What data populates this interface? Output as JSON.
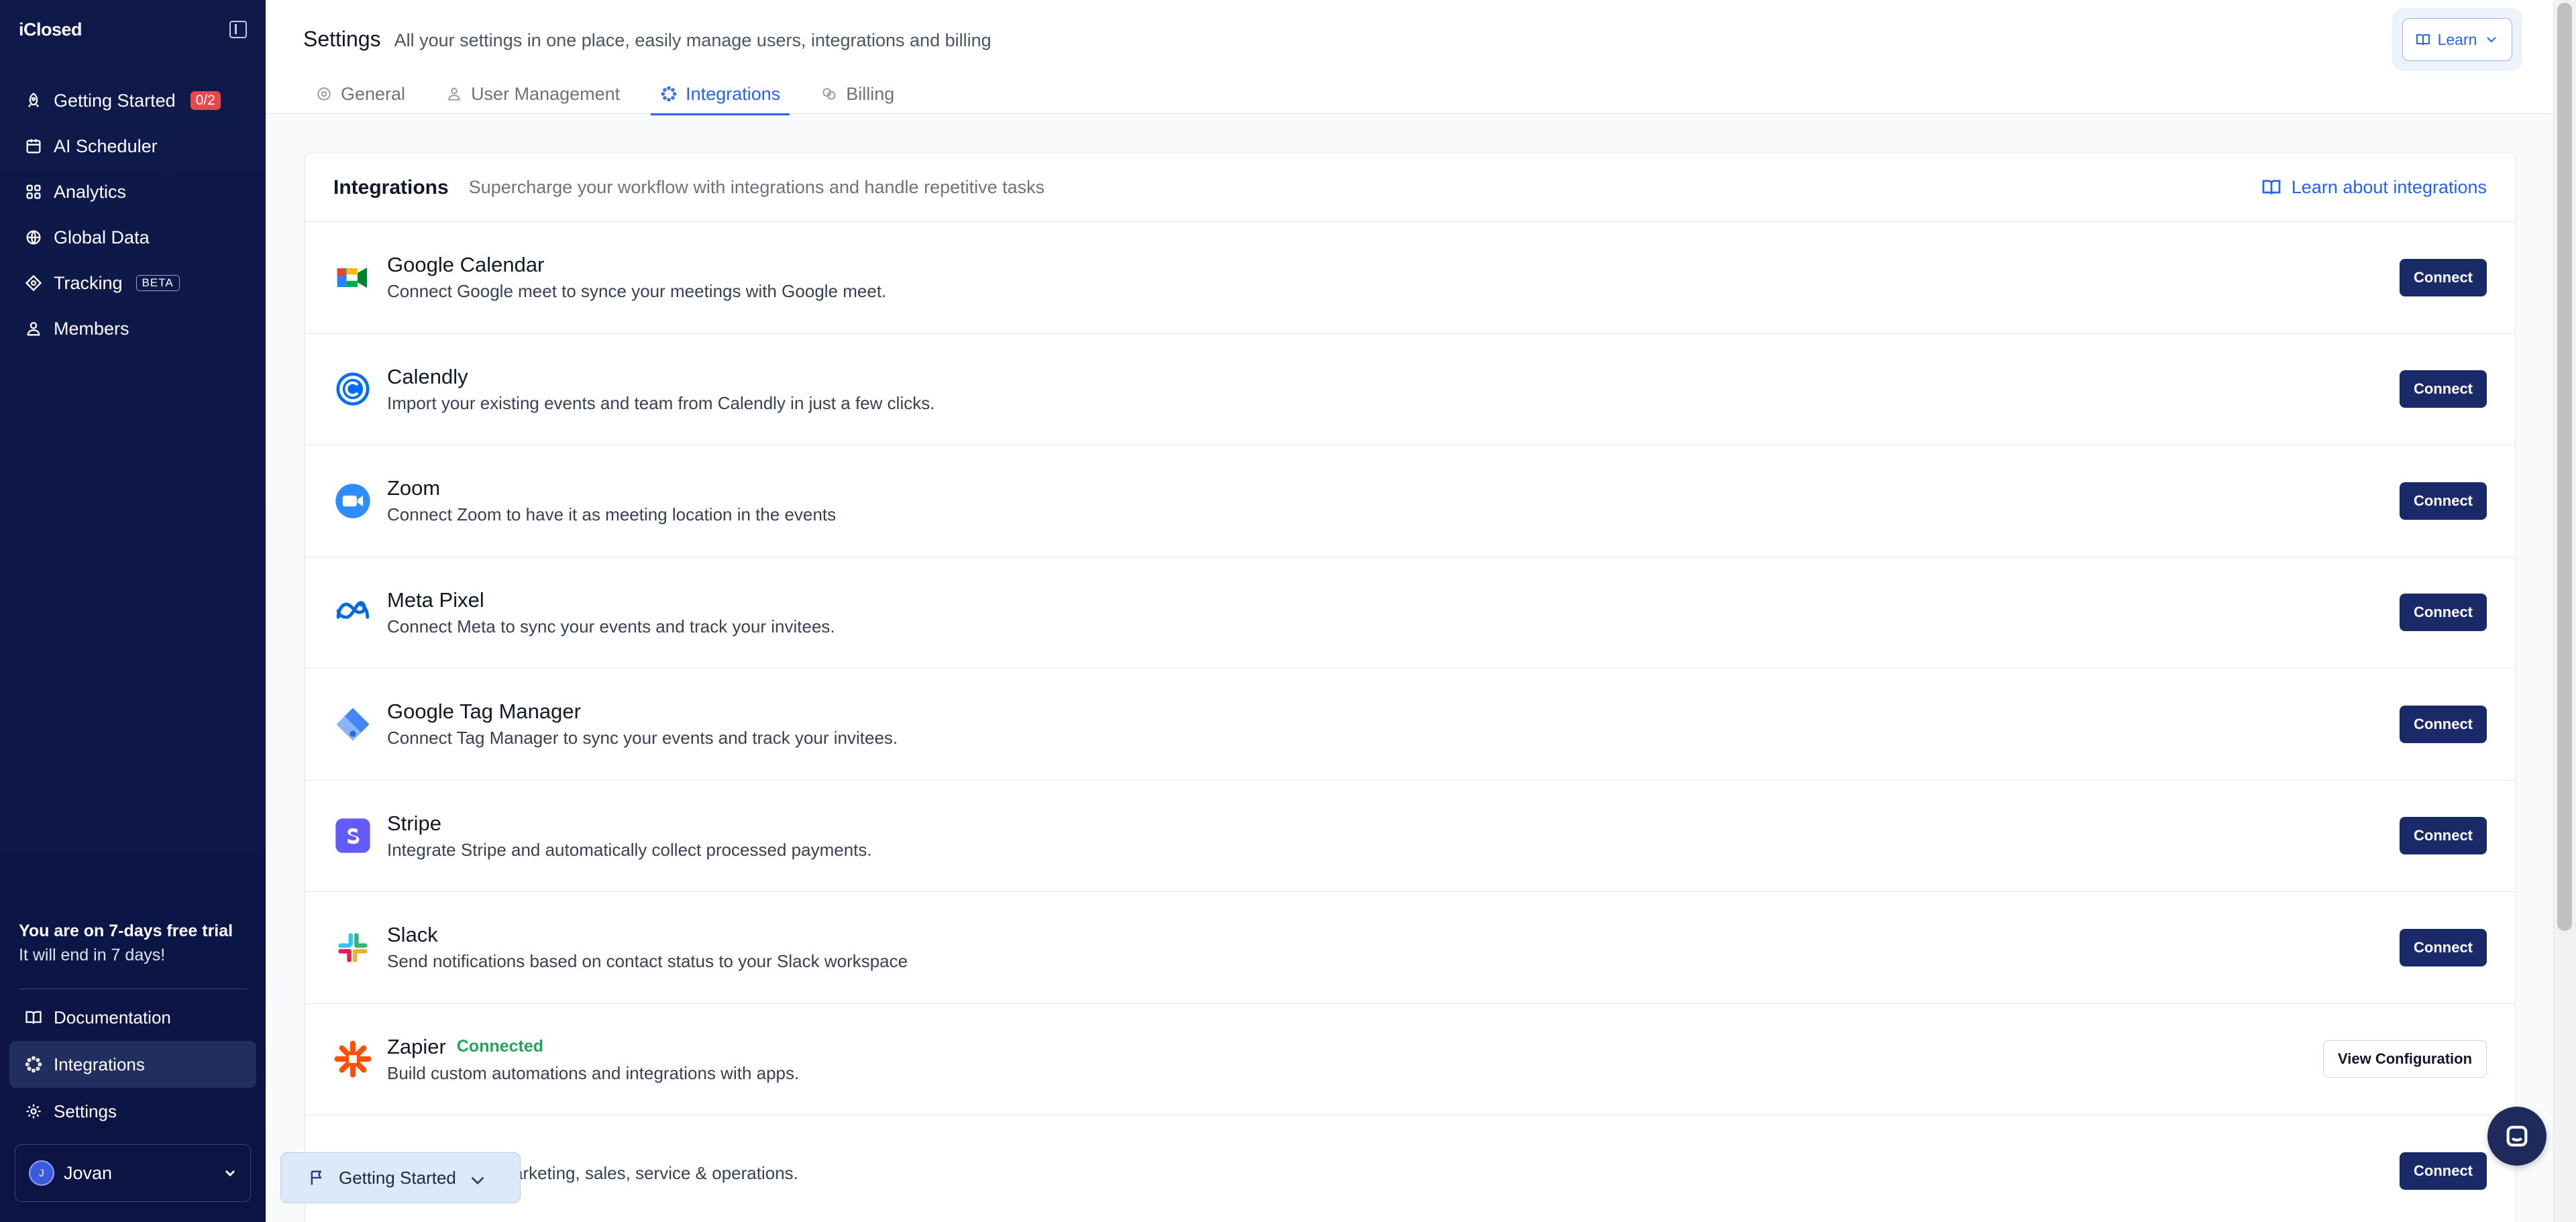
{
  "sidebar": {
    "logo": "iClosed",
    "nav": [
      {
        "label": "Getting Started",
        "icon": "rocket-icon",
        "badge": "0/2"
      },
      {
        "label": "AI Scheduler",
        "icon": "calendar-icon"
      },
      {
        "label": "Analytics",
        "icon": "grid-icon"
      },
      {
        "label": "Global Data",
        "icon": "globe-icon"
      },
      {
        "label": "Tracking",
        "icon": "target-icon",
        "tag": "BETA"
      },
      {
        "label": "Members",
        "icon": "users-icon"
      }
    ],
    "trial_title": "You are on 7-days free trial",
    "trial_sub": "It will end in 7 days!",
    "bottom": [
      {
        "label": "Documentation",
        "icon": "book-icon"
      },
      {
        "label": "Integrations",
        "icon": "integrations-icon"
      },
      {
        "label": "Settings",
        "icon": "gear-icon"
      }
    ],
    "user": {
      "initial": "J",
      "name": "Jovan"
    }
  },
  "header": {
    "title": "Settings",
    "subtitle": "All your settings in one place, easily manage users, integrations and billing",
    "tabs": [
      {
        "label": "General"
      },
      {
        "label": "User Management"
      },
      {
        "label": "Integrations"
      },
      {
        "label": "Billing"
      }
    ],
    "active_tab": "Integrations",
    "learn_label": "Learn"
  },
  "card": {
    "title": "Integrations",
    "subtitle": "Supercharge your workflow with integrations and handle repetitive tasks",
    "learn_link": "Learn about integrations",
    "items": [
      {
        "name": "Google Calendar",
        "desc": "Connect Google meet to syncе your meetings with Google meet.",
        "action": "Connect",
        "icon": "google-meet-icon"
      },
      {
        "name": "Calendly",
        "desc": "Import your existing events and team from Calendly in just a few clicks.",
        "action": "Connect",
        "icon": "calendly-icon"
      },
      {
        "name": "Zoom",
        "desc": "Connect Zoom to have it as meeting location in the events",
        "action": "Connect",
        "icon": "zoom-icon"
      },
      {
        "name": "Meta Pixel",
        "desc": "Connect Meta to sync your events and track your invitees.",
        "action": "Connect",
        "icon": "meta-icon"
      },
      {
        "name": "Google Tag Manager",
        "desc": "Connect Tag Manager to sync your events and track your invitees.",
        "action": "Connect",
        "icon": "gtm-icon"
      },
      {
        "name": "Stripe",
        "desc": "Integrate Stripe and automatically collect processed payments.",
        "action": "Connect",
        "icon": "stripe-icon"
      },
      {
        "name": "Slack",
        "desc": "Send notifications based on contact status to your Slack workspace",
        "action": "Connect",
        "icon": "slack-icon"
      },
      {
        "name": "Zapier",
        "status": "Connected",
        "desc": "Build custom automations and integrations with apps.",
        "action": "View Configuration",
        "icon": "zapier-icon"
      },
      {
        "name": "",
        "desc": "arketing, sales, service & operations.",
        "action": "Connect",
        "icon": "hubspot-icon"
      }
    ]
  },
  "floating": {
    "getting_started": "Getting Started"
  }
}
